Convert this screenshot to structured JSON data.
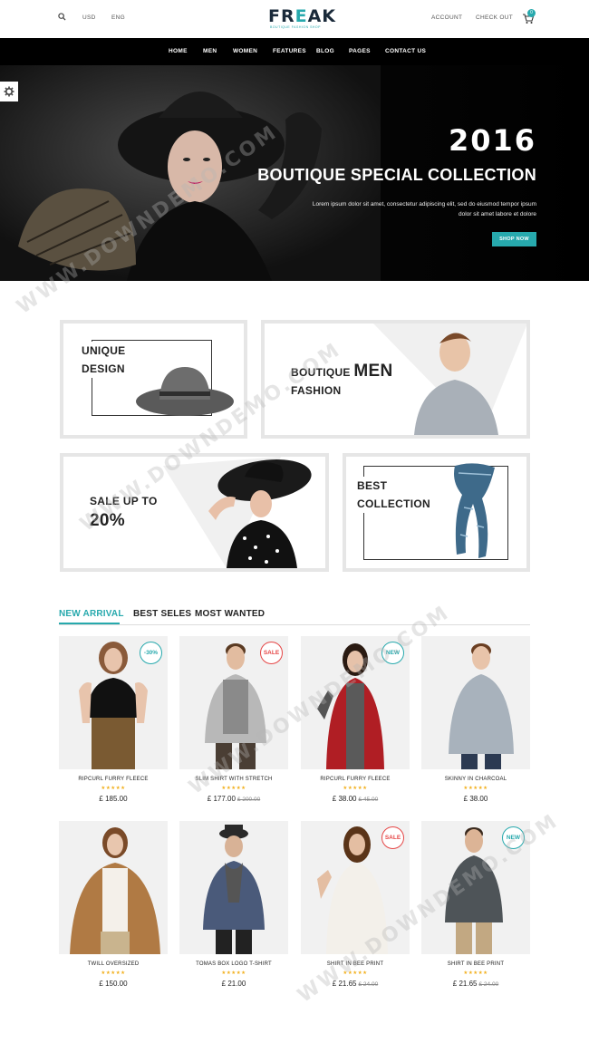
{
  "topbar": {
    "currency": "USD",
    "language": "ENG",
    "account": "ACCOUNT",
    "checkout": "CHECK OUT",
    "cart_count": "0"
  },
  "logo": {
    "name_a": "FR",
    "name_e": "E",
    "name_b": "AK",
    "tagline": "Boutique fashion shop"
  },
  "nav": {
    "items": [
      "HOME",
      "MEN",
      "WOMEN",
      "FEATURES",
      "BLOG",
      "PAGES",
      "CONTACT US"
    ]
  },
  "hero": {
    "year": "2016",
    "title": "BOUTIQUE SPECIAL COLLECTION",
    "text_line1": "Lorem ipsum dolor sit amet, consectetur adipiscing elit, sed do eiusmod tempor ipsum",
    "text_line2": "dolor sit amet labore et dolore",
    "button": "SHOP NOW"
  },
  "banners": {
    "unique_line1": "UNIQUE",
    "unique_line2": "DESIGN",
    "men_line1": "BOUTIQUE",
    "men_big": "MEN",
    "men_line2": "FASHION",
    "sale_line1": "SALE UP TO",
    "sale_line2": "20%",
    "best_line1": "BEST",
    "best_line2": "COLLECTION"
  },
  "tabs": {
    "items": [
      "NEW ARRIVAL",
      "BEST SELES",
      "MOST WANTED"
    ]
  },
  "products": [
    {
      "name": "RIPCURL FURRY FLEECE",
      "stars": "★★★★★",
      "price": "£ 185.00",
      "old": "",
      "badge": "-30%"
    },
    {
      "name": "SLIM SHIRT WITH STRETCH",
      "stars": "★★★★★",
      "price": "£ 177.00",
      "old": "£ 200.00",
      "badge": "SALE"
    },
    {
      "name": "RIPCURL FURRY FLEECE",
      "stars": "★★★★★",
      "price": "£ 38.00",
      "old": "£ 45.00",
      "badge": "NEW"
    },
    {
      "name": "SKINNY IN CHARCOAL",
      "stars": "★★★★★",
      "price": "£ 38.00",
      "old": "",
      "badge": ""
    },
    {
      "name": "TWILL OVERSIZED",
      "stars": "★★★★★",
      "price": "£ 150.00",
      "old": "",
      "badge": ""
    },
    {
      "name": "TOMAS BOX LOGO T-SHIRT",
      "stars": "★★★★★",
      "price": "£ 21.00",
      "old": "",
      "badge": ""
    },
    {
      "name": "SHIRT IN BEE PRINT",
      "stars": "★★★★★",
      "price": "£ 21.65",
      "old": "£ 24.00",
      "badge": "SALE"
    },
    {
      "name": "SHIRT IN BEE PRINT",
      "stars": "★★★★★",
      "price": "£ 21.65",
      "old": "£ 24.00",
      "badge": "NEW"
    }
  ],
  "watermark": "WWW.DOWNDEMO.COM",
  "colors": {
    "accent": "#27a9ad",
    "sale": "#e54646",
    "star": "#f2b01e"
  }
}
